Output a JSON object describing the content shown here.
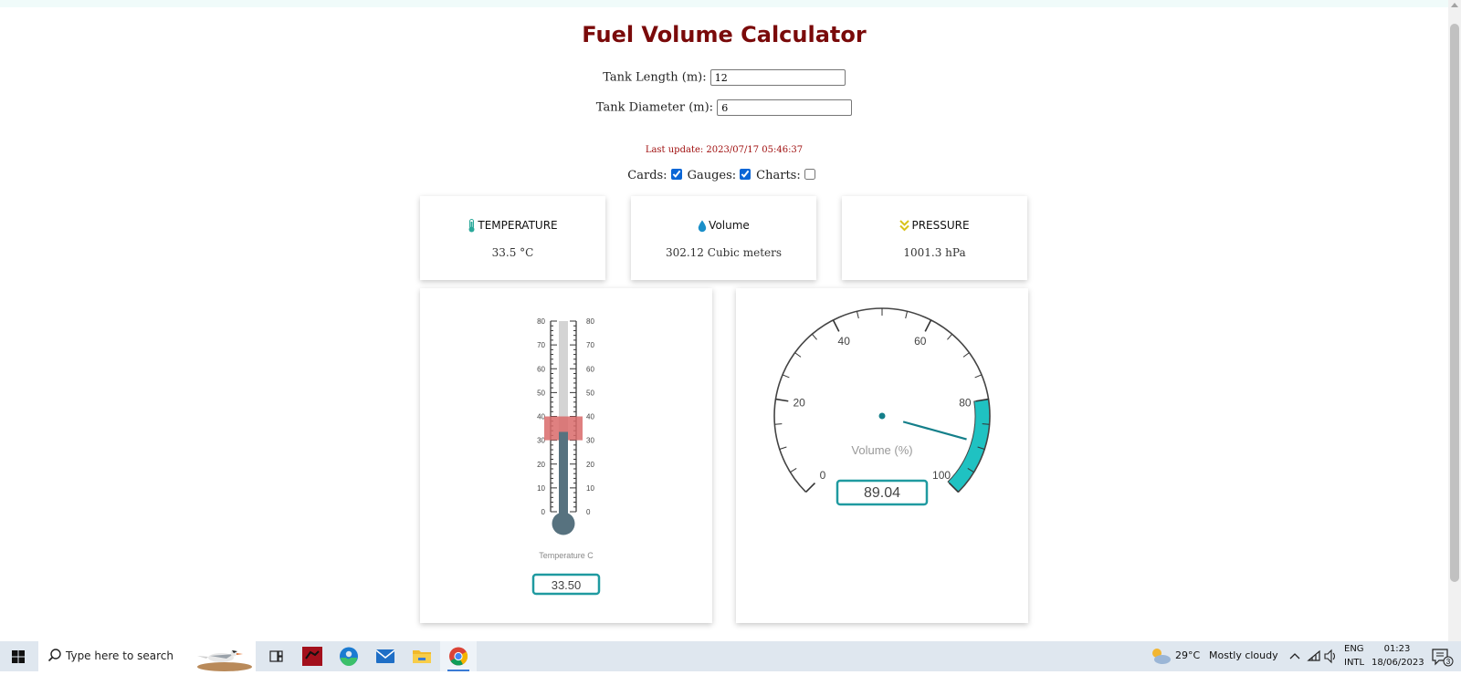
{
  "page": {
    "title": "Fuel Volume Calculator",
    "last_update": "Last update: 2023/07/17 05:46:37"
  },
  "form": {
    "length_label": "Tank Length (m):",
    "length_value": "12",
    "diameter_label": "Tank Diameter (m):",
    "diameter_value": "6"
  },
  "toggles": {
    "cards_label": "Cards:",
    "cards_checked": true,
    "gauges_label": "Gauges:",
    "gauges_checked": true,
    "charts_label": "Charts:",
    "charts_checked": false
  },
  "cards": [
    {
      "icon": "thermometer-icon",
      "title": "TEMPERATURE",
      "value": "33.5 °C",
      "color": "#2aa89a"
    },
    {
      "icon": "water-drop-icon",
      "title": "Volume",
      "value": "302.12 Cubic meters",
      "color": "#1a8fc9"
    },
    {
      "icon": "double-chevron-down-icon",
      "title": "PRESSURE",
      "value": "1001.3 hPa",
      "color": "#d8c21a"
    }
  ],
  "thermometer": {
    "caption": "Temperature C",
    "readout": "33.50",
    "value": 33.5,
    "min": 0,
    "max": 80,
    "ticks": [
      "80",
      "70",
      "60",
      "50",
      "40",
      "30",
      "20",
      "10",
      "0"
    ],
    "highlight_range": [
      30,
      40
    ],
    "colors": {
      "mercury": "#57727f",
      "highlight": "#d96a6a",
      "tube": "#d4d4d4",
      "readout_border": "#1f9aa0"
    }
  },
  "volume_gauge": {
    "title": "Volume (%)",
    "readout": "89.04",
    "value": 89.04,
    "min": 0,
    "max": 100,
    "major_labels": [
      "0",
      "20",
      "40",
      "60",
      "80",
      "100"
    ],
    "band_range": [
      80,
      100
    ],
    "colors": {
      "band": "#1fc2c2",
      "needle": "#147f8a",
      "readout_border": "#1f9aa0"
    }
  },
  "taskbar": {
    "search_placeholder": "Type here to search",
    "weather_temp": "29°C",
    "weather_text": "Mostly cloudy",
    "lang_top": "ENG",
    "lang_bottom": "INTL",
    "time": "01:23",
    "date": "18/06/2023",
    "notification_count": "3",
    "apps": [
      "task-view",
      "red-app",
      "edge",
      "mail",
      "file-explorer",
      "chrome"
    ]
  }
}
